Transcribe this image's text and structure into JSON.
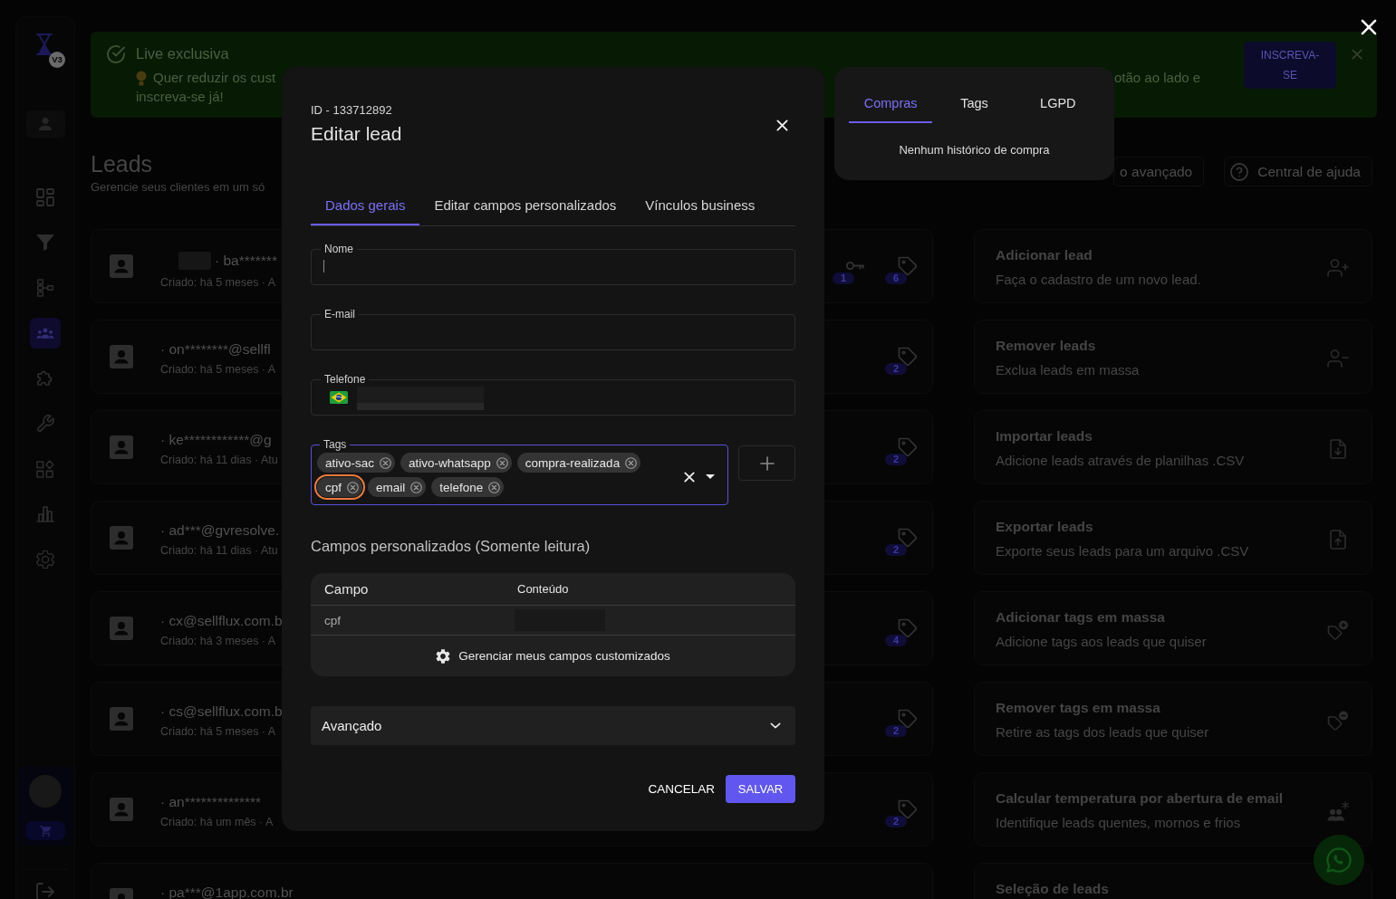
{
  "sidebar": {
    "logo_badge": "V3",
    "nav": [
      {
        "kind": "dashboard",
        "selected": false
      },
      {
        "kind": "funnel",
        "selected": false
      },
      {
        "kind": "hierarchy",
        "selected": false
      },
      {
        "kind": "group",
        "selected": true
      },
      {
        "kind": "puzzle",
        "selected": false
      },
      {
        "kind": "wrench",
        "selected": false
      },
      {
        "kind": "widgets",
        "selected": false
      },
      {
        "kind": "chart",
        "selected": false
      },
      {
        "kind": "settings",
        "selected": false
      }
    ]
  },
  "banner": {
    "title": "Live exclusiva",
    "line_start": "Quer reduzir os cust",
    "line_end": "otão ao lado e",
    "line_2": "inscreva-se já!",
    "button": "INSCREVA-SE"
  },
  "header": {
    "title": "Leads",
    "subtitle": "Gerencie seus clientes em um só",
    "filter_button": "o avançado",
    "help_button": "Central de ajuda"
  },
  "leads": [
    {
      "redacted": true,
      "name": "· ba*******",
      "created": "Criado: há 5 meses · A",
      "key_count": "1",
      "tag_count": "6"
    },
    {
      "redacted": false,
      "name": "· on********@sellfl",
      "created": "Criado: há 5 meses · A",
      "tag_count": "2"
    },
    {
      "redacted": false,
      "name": "· ke************@g",
      "created": "Criado: há 11 dias · Atu",
      "tag_count": "2"
    },
    {
      "redacted": false,
      "name": "· ad***@gvresolve.",
      "created": "Criado: há 11 dias · Atu",
      "tag_count": "2"
    },
    {
      "redacted": false,
      "name": "· cx@sellflux.com.b",
      "created": "Criado: há 3 meses · A",
      "tag_count": "4"
    },
    {
      "redacted": false,
      "name": "· cs@sellflux.com.b",
      "created": "Criado: há 5 meses · A",
      "tag_count": "2"
    },
    {
      "redacted": false,
      "name": "· an**************",
      "created": "Criado: há um mês · A",
      "tag_count": "2"
    },
    {
      "redacted": false,
      "name": "· pa***@1app.com.br"
    }
  ],
  "actions": [
    {
      "kind": "user-add",
      "title": "Adicionar lead",
      "description": "Faça o cadastro de um novo lead."
    },
    {
      "kind": "user-remove",
      "title": "Remover leads",
      "description": "Exclua leads em massa"
    },
    {
      "kind": "import",
      "title": "Importar leads",
      "description": "Adicione leads através de planilhas .CSV"
    },
    {
      "kind": "export",
      "title": "Exportar leads",
      "description": "Exporte seus leads para um arquivo .CSV"
    },
    {
      "kind": "tag-add",
      "title": "Adicionar tags em massa",
      "description": "Adicione tags aos leads que quiser"
    },
    {
      "kind": "tag-remove",
      "title": "Remover tags em massa",
      "description": "Retire as tags dos leads que quiser"
    },
    {
      "kind": "temperature",
      "title": "Calcular temperatura por abertura de email",
      "description": "Identifique leads quentes, mornos e frios"
    },
    {
      "kind": "selection",
      "title": "Seleção de leads"
    }
  ],
  "dialog": {
    "id_label": "ID - 133712892",
    "title": "Editar lead",
    "tabs": [
      {
        "label": "Dados gerais",
        "selected": true
      },
      {
        "label": "Editar campos personalizados",
        "selected": false
      },
      {
        "label": "Vínculos business",
        "selected": false
      }
    ],
    "fields": [
      {
        "kind": "text",
        "label": "Nome",
        "caret": true,
        "redacted": false
      },
      {
        "kind": "text",
        "label": "E-mail",
        "caret": false,
        "redacted": false
      },
      {
        "kind": "phone",
        "label": "Telefone",
        "caret": false,
        "redacted": true
      }
    ],
    "tags": {
      "label": "Tags",
      "focused": true,
      "chips": [
        {
          "label": "ativo-sac",
          "selected": false
        },
        {
          "label": "ativo-whatsapp",
          "selected": false
        },
        {
          "label": "compra-realizada",
          "selected": false
        },
        {
          "label": "cpf",
          "selected": true
        },
        {
          "label": "email",
          "selected": false
        },
        {
          "label": "telefone",
          "selected": false
        }
      ]
    },
    "custom_fields": {
      "heading": "Campos personalizados (Somente leitura)",
      "columns": [
        "Campo",
        "Conteúdo"
      ],
      "rows": [
        {
          "field": "cpf",
          "redacted": true
        }
      ],
      "manage_button": "Gerenciar meus campos customizados"
    },
    "advanced": {
      "label": "Avançado",
      "expanded": false
    },
    "buttons": {
      "cancel": "CANCELAR",
      "save": "SALVAR"
    }
  },
  "purchases_popover": {
    "tabs": [
      {
        "label": "Compras",
        "selected": true
      },
      {
        "label": "Tags",
        "selected": false
      },
      {
        "label": "LGPD",
        "selected": false
      }
    ],
    "empty_text": "Nenhum histórico de compra"
  }
}
